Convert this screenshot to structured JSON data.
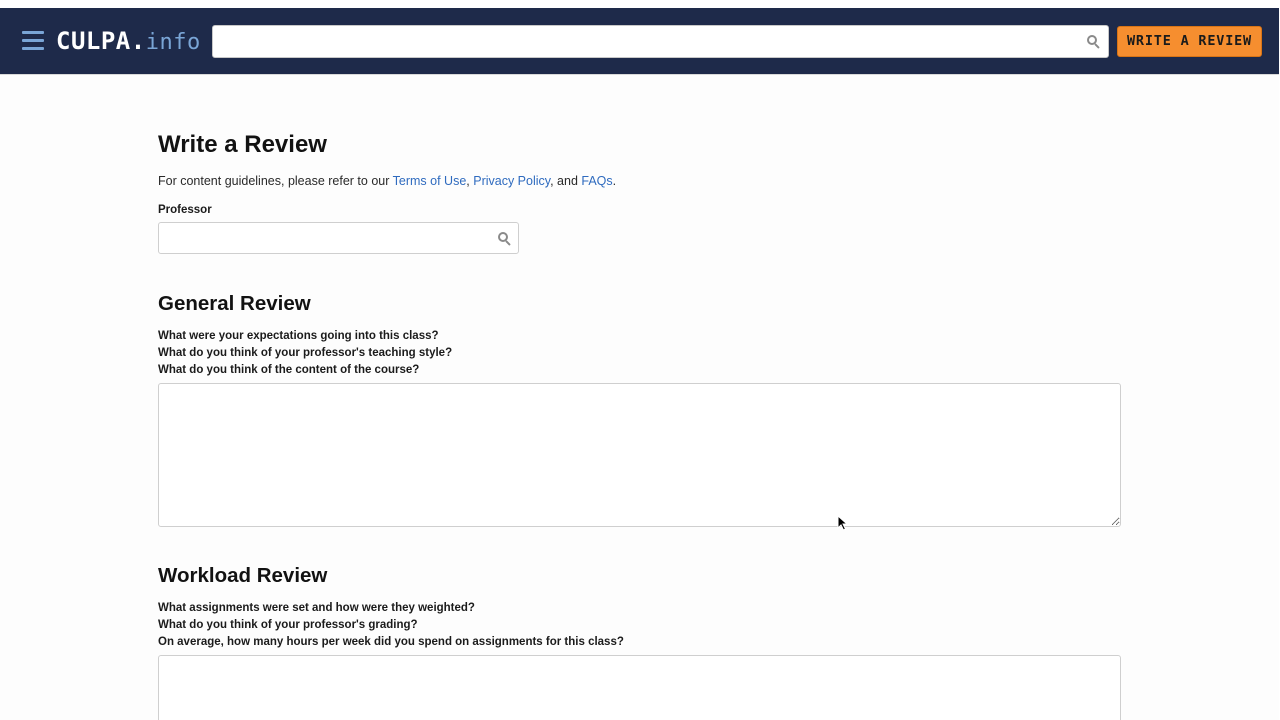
{
  "navbar": {
    "logo_main": "CULPA",
    "logo_dot": ".",
    "logo_sub": "info",
    "search_placeholder": "",
    "write_review_label": "WRITE A REVIEW"
  },
  "page": {
    "title": "Write a Review",
    "guidelines_prefix": "For content guidelines, please refer to our ",
    "link_terms": "Terms of Use",
    "sep_comma": ", ",
    "link_privacy": "Privacy Policy",
    "sep_and": ", and ",
    "link_faqs": "FAQs",
    "guidelines_suffix": "."
  },
  "professor": {
    "label": "Professor",
    "placeholder": ""
  },
  "general_review": {
    "title": "General Review",
    "prompts": [
      "What were your expectations going into this class?",
      "What do you think of your professor's teaching style?",
      "What do you think of the content of the course?"
    ],
    "value": ""
  },
  "workload_review": {
    "title": "Workload Review",
    "prompts": [
      "What assignments were set and how were they weighted?",
      "What do you think of your professor's grading?",
      "On average, how many hours per week did you spend on assignments for this class?"
    ],
    "value": ""
  },
  "icons": {
    "menu": "hamburger-menu-icon",
    "search": "search-icon",
    "cursor": "mouse-pointer-icon"
  },
  "colors": {
    "navbar_bg": "#1e2a4a",
    "accent_orange": "#f68e2f",
    "logo_sub": "#7aa5d6",
    "link_blue": "#2f6bbf"
  }
}
